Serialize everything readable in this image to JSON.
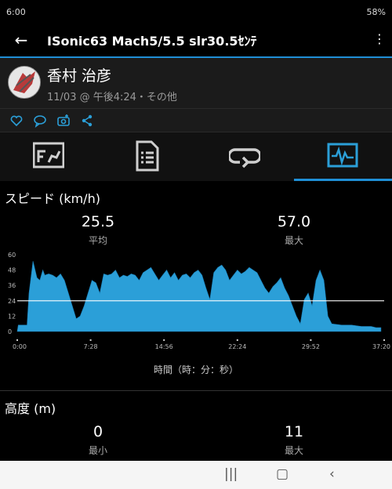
{
  "status": {
    "time": "6:00",
    "right": "58%"
  },
  "appbar": {
    "title": "ISonic63 Mach5/5.5  slr30.5ｾﾝﾃ"
  },
  "activity": {
    "user": "香村 治彦",
    "meta": "11/03 @ 午後4:24・その他"
  },
  "tabs": [
    {
      "icon": "summary-icon"
    },
    {
      "icon": "details-icon"
    },
    {
      "icon": "laps-icon"
    },
    {
      "icon": "charts-icon",
      "selected": true
    }
  ],
  "speed": {
    "title": "スピード (km/h)",
    "avg_value": "25.5",
    "avg_label": "平均",
    "max_value": "57.0",
    "max_label": "最大"
  },
  "chart_data": {
    "type": "area",
    "y_ticks": [
      "60",
      "48",
      "36",
      "24",
      "12",
      "0"
    ],
    "x_ticks": [
      "0:00",
      "7:28",
      "14:56",
      "22:24",
      "29:52",
      "37:20"
    ],
    "xlabel": "時間（時：分：秒）",
    "ylim": [
      0,
      60
    ],
    "xlim_minutes": [
      0,
      37.33
    ],
    "reference_line": 24,
    "color": "#2b9fd8",
    "grid": false,
    "series": [
      {
        "x": [
          0.0,
          0.1,
          1.0,
          1.2,
          1.6,
          2.0,
          2.3,
          2.6,
          2.8,
          3.2,
          3.6,
          4.0,
          4.4,
          4.8,
          5.2,
          5.6,
          6.0,
          6.4,
          6.8,
          7.2,
          7.6,
          8.0,
          8.4,
          8.8,
          9.2,
          9.6,
          10.0,
          10.4,
          10.8,
          11.2,
          11.6,
          12.0,
          12.4,
          12.8,
          13.2,
          13.6,
          14.0,
          14.4,
          14.8,
          15.2,
          15.6,
          16.0,
          16.4,
          16.8,
          17.2,
          17.6,
          18.0,
          18.4,
          18.8,
          19.2,
          19.6,
          20.0,
          20.4,
          20.8,
          21.2,
          21.6,
          22.0,
          22.4,
          22.8,
          23.2,
          23.6,
          24.0,
          24.4,
          24.8,
          25.2,
          25.6,
          26.0,
          26.4,
          26.8,
          27.2,
          27.6,
          28.0,
          28.4,
          28.8,
          29.2,
          29.6,
          30.0,
          30.4,
          30.8,
          31.2,
          31.6,
          32.0,
          33.0,
          34.0,
          35.0,
          36.0,
          36.5,
          37.0
        ],
        "y": [
          0,
          5,
          5,
          30,
          55,
          42,
          40,
          48,
          44,
          45,
          44,
          42,
          45,
          40,
          30,
          20,
          10,
          12,
          20,
          30,
          40,
          38,
          30,
          45,
          44,
          45,
          48,
          42,
          44,
          43,
          45,
          44,
          40,
          46,
          48,
          50,
          45,
          40,
          44,
          48,
          42,
          46,
          40,
          44,
          45,
          42,
          46,
          48,
          44,
          34,
          25,
          46,
          50,
          52,
          48,
          40,
          44,
          48,
          45,
          47,
          50,
          48,
          46,
          40,
          34,
          30,
          35,
          38,
          42,
          34,
          28,
          20,
          12,
          6,
          25,
          30,
          20,
          40,
          48,
          40,
          12,
          6,
          5,
          5,
          4,
          4,
          3,
          3
        ]
      }
    ]
  },
  "time_label": "時間（時：分：秒）",
  "elevation": {
    "title": "高度 (m)",
    "min_value": "0",
    "min_label": "最小",
    "max_value": "11",
    "max_label": "最大"
  }
}
